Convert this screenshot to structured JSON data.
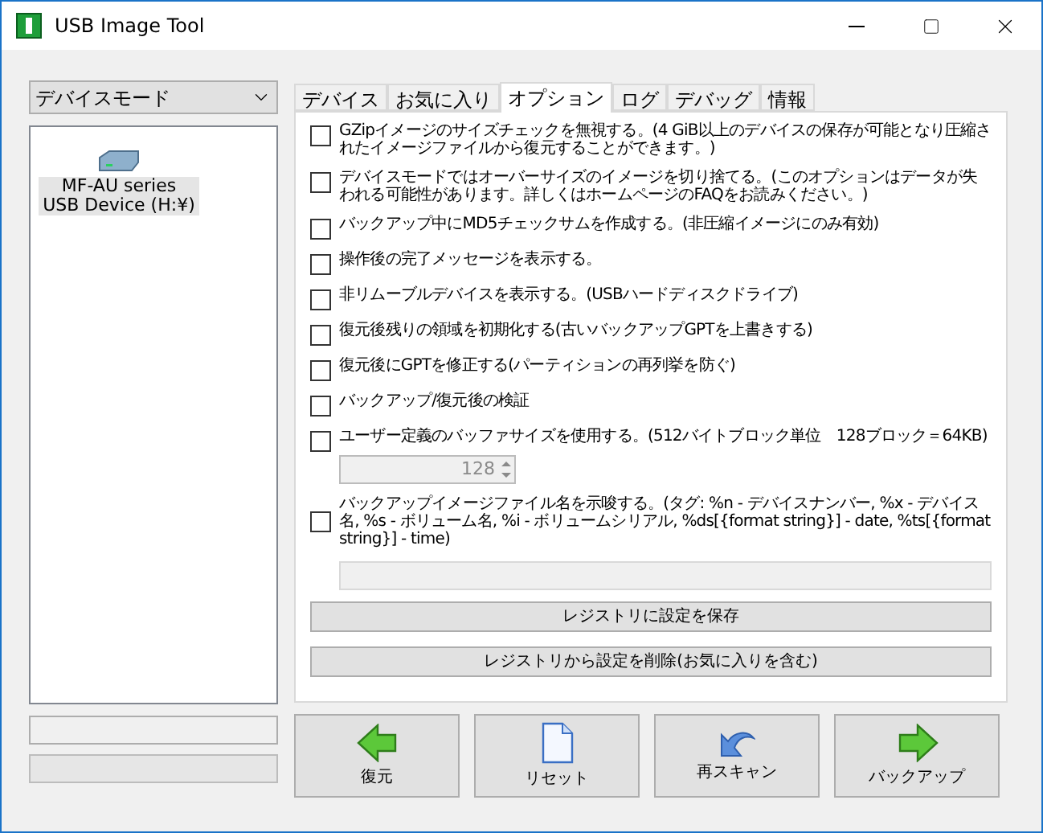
{
  "window": {
    "title": "USB Image Tool"
  },
  "mode_select": {
    "value": "デバイスモード"
  },
  "devices": [
    {
      "name": "MF-AU series USB Device (H:¥)",
      "selected": true
    }
  ],
  "tabs": [
    {
      "label": "デバイス",
      "selected": false
    },
    {
      "label": "お気に入り",
      "selected": false
    },
    {
      "label": "オプション",
      "selected": true
    },
    {
      "label": "ログ",
      "selected": false
    },
    {
      "label": "デバッグ",
      "selected": false
    },
    {
      "label": "情報",
      "selected": false
    }
  ],
  "options": [
    {
      "kind": "plain",
      "label": "GZipイメージのサイズチェックを無視する。(4 GiB以上のデバイスの保存が可能となり圧縮されたイメージファイルから復元することができます。)",
      "checked": false
    },
    {
      "kind": "plain",
      "label": "デバイスモードではオーバーサイズのイメージを切り捨てる。(このオプションはデータが失われる可能性があります。詳しくはホームページのFAQをお読みください。)",
      "checked": false
    },
    {
      "kind": "plain",
      "label": "バックアップ中にMD5チェックサムを作成する。(非圧縮イメージにのみ有効)",
      "checked": false
    },
    {
      "kind": "plain",
      "label": "操作後の完了メッセージを表示する。",
      "checked": false
    },
    {
      "kind": "plain",
      "label": "非リムーブルデバイスを表示する。(USBハードディスクドライブ)",
      "checked": false
    },
    {
      "kind": "plain",
      "label": "復元後残りの領域を初期化する(古いバックアップGPTを上書きする)",
      "checked": false
    },
    {
      "kind": "plain",
      "label": "復元後にGPTを修正する(パーティションの再列挙を防ぐ)",
      "checked": false
    },
    {
      "kind": "plain",
      "label": "バックアップ/復元後の検証",
      "checked": false
    },
    {
      "kind": "spinner",
      "label": "ユーザー定義のバッファサイズを使用する。(512バイトブロック単位　128ブロック＝64KB)",
      "checked": false,
      "value": "128",
      "disabled": true
    },
    {
      "kind": "field",
      "label": "バックアップイメージファイル名を示唆する。(タグ: %n - デバイスナンバー, %x - デバイス名, %s - ボリューム名, %i - ボリュームシリアル, %ds[{format string}] - date, %ts[{format string}] - time)",
      "checked": false,
      "disabled": true
    }
  ],
  "settings_buttons": [
    "レジストリに設定を保存",
    "レジストリから設定を削除(お気に入りを含む)"
  ],
  "actions": [
    {
      "kind": "restore",
      "label": "復元"
    },
    {
      "kind": "reset",
      "label": "リセット"
    },
    {
      "kind": "rescan",
      "label": "再スキャン"
    },
    {
      "kind": "backup",
      "label": "バックアップ"
    }
  ]
}
